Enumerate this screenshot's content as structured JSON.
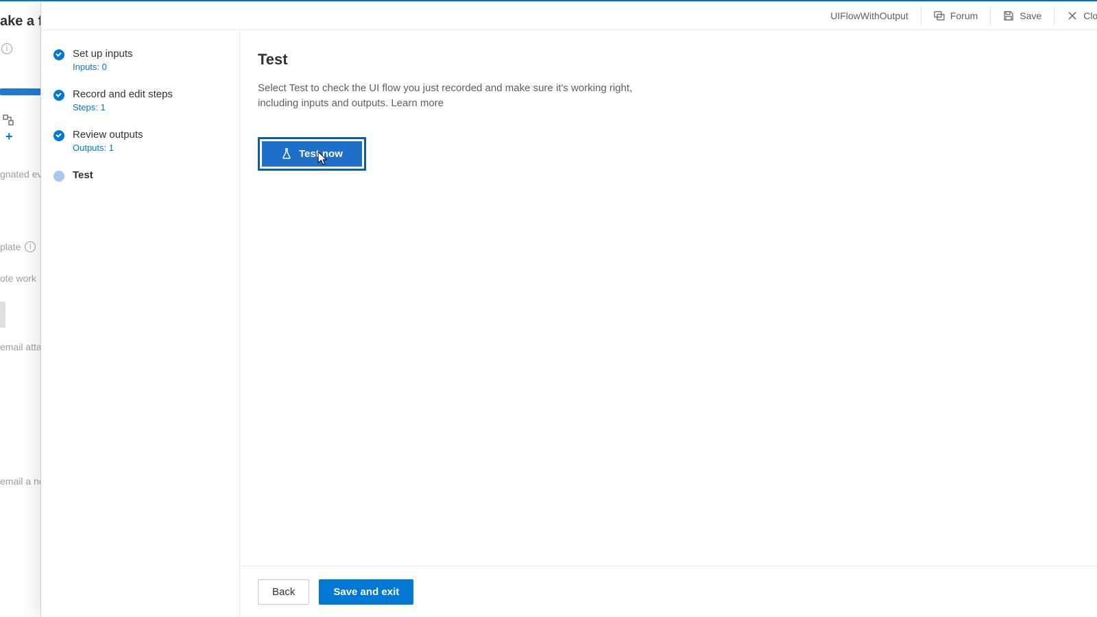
{
  "background": {
    "title_fragment": "ake a flo",
    "text_fragment_1": "gnated even",
    "text_fragment_2": "plate",
    "text_fragment_3": "ote work",
    "text_fragment_4": "email attac",
    "text_fragment_5": "email a no"
  },
  "topbar": {
    "flow_name": "UIFlowWithOutput",
    "forum": "Forum",
    "save": "Save",
    "close": "Close"
  },
  "steps": [
    {
      "label": "Set up inputs",
      "sub": "Inputs: 0",
      "state": "done"
    },
    {
      "label": "Record and edit steps",
      "sub": "Steps: 1",
      "state": "done"
    },
    {
      "label": "Review outputs",
      "sub": "Outputs: 1",
      "state": "done"
    },
    {
      "label": "Test",
      "sub": "",
      "state": "current"
    }
  ],
  "main": {
    "heading": "Test",
    "description": "Select Test to check the UI flow you just recorded and make sure it's working right, including inputs and outputs. ",
    "learn_more": "Learn more",
    "test_now": "Test now"
  },
  "footer": {
    "back": "Back",
    "save_and_exit": "Save and exit"
  }
}
